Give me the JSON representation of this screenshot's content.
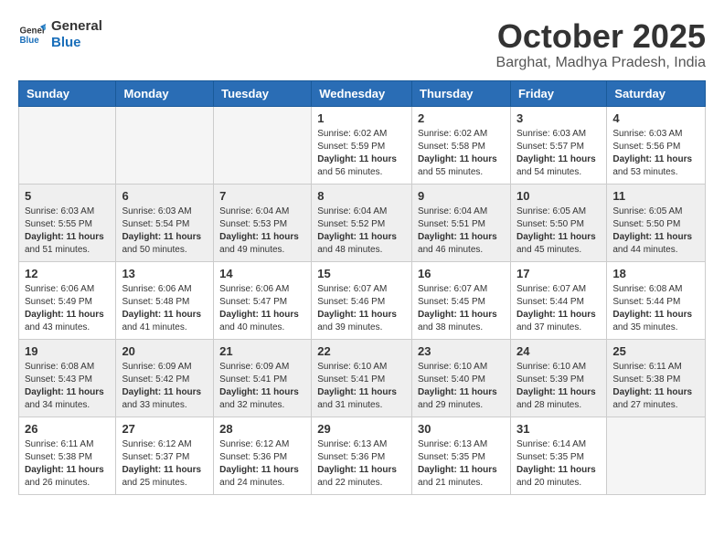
{
  "header": {
    "logo_line1": "General",
    "logo_line2": "Blue",
    "month_title": "October 2025",
    "subtitle": "Barghat, Madhya Pradesh, India"
  },
  "weekdays": [
    "Sunday",
    "Monday",
    "Tuesday",
    "Wednesday",
    "Thursday",
    "Friday",
    "Saturday"
  ],
  "weeks": [
    [
      {
        "day": "",
        "info": ""
      },
      {
        "day": "",
        "info": ""
      },
      {
        "day": "",
        "info": ""
      },
      {
        "day": "1",
        "info": "Sunrise: 6:02 AM\nSunset: 5:59 PM\nDaylight: 11 hours\nand 56 minutes."
      },
      {
        "day": "2",
        "info": "Sunrise: 6:02 AM\nSunset: 5:58 PM\nDaylight: 11 hours\nand 55 minutes."
      },
      {
        "day": "3",
        "info": "Sunrise: 6:03 AM\nSunset: 5:57 PM\nDaylight: 11 hours\nand 54 minutes."
      },
      {
        "day": "4",
        "info": "Sunrise: 6:03 AM\nSunset: 5:56 PM\nDaylight: 11 hours\nand 53 minutes."
      }
    ],
    [
      {
        "day": "5",
        "info": "Sunrise: 6:03 AM\nSunset: 5:55 PM\nDaylight: 11 hours\nand 51 minutes."
      },
      {
        "day": "6",
        "info": "Sunrise: 6:03 AM\nSunset: 5:54 PM\nDaylight: 11 hours\nand 50 minutes."
      },
      {
        "day": "7",
        "info": "Sunrise: 6:04 AM\nSunset: 5:53 PM\nDaylight: 11 hours\nand 49 minutes."
      },
      {
        "day": "8",
        "info": "Sunrise: 6:04 AM\nSunset: 5:52 PM\nDaylight: 11 hours\nand 48 minutes."
      },
      {
        "day": "9",
        "info": "Sunrise: 6:04 AM\nSunset: 5:51 PM\nDaylight: 11 hours\nand 46 minutes."
      },
      {
        "day": "10",
        "info": "Sunrise: 6:05 AM\nSunset: 5:50 PM\nDaylight: 11 hours\nand 45 minutes."
      },
      {
        "day": "11",
        "info": "Sunrise: 6:05 AM\nSunset: 5:50 PM\nDaylight: 11 hours\nand 44 minutes."
      }
    ],
    [
      {
        "day": "12",
        "info": "Sunrise: 6:06 AM\nSunset: 5:49 PM\nDaylight: 11 hours\nand 43 minutes."
      },
      {
        "day": "13",
        "info": "Sunrise: 6:06 AM\nSunset: 5:48 PM\nDaylight: 11 hours\nand 41 minutes."
      },
      {
        "day": "14",
        "info": "Sunrise: 6:06 AM\nSunset: 5:47 PM\nDaylight: 11 hours\nand 40 minutes."
      },
      {
        "day": "15",
        "info": "Sunrise: 6:07 AM\nSunset: 5:46 PM\nDaylight: 11 hours\nand 39 minutes."
      },
      {
        "day": "16",
        "info": "Sunrise: 6:07 AM\nSunset: 5:45 PM\nDaylight: 11 hours\nand 38 minutes."
      },
      {
        "day": "17",
        "info": "Sunrise: 6:07 AM\nSunset: 5:44 PM\nDaylight: 11 hours\nand 37 minutes."
      },
      {
        "day": "18",
        "info": "Sunrise: 6:08 AM\nSunset: 5:44 PM\nDaylight: 11 hours\nand 35 minutes."
      }
    ],
    [
      {
        "day": "19",
        "info": "Sunrise: 6:08 AM\nSunset: 5:43 PM\nDaylight: 11 hours\nand 34 minutes."
      },
      {
        "day": "20",
        "info": "Sunrise: 6:09 AM\nSunset: 5:42 PM\nDaylight: 11 hours\nand 33 minutes."
      },
      {
        "day": "21",
        "info": "Sunrise: 6:09 AM\nSunset: 5:41 PM\nDaylight: 11 hours\nand 32 minutes."
      },
      {
        "day": "22",
        "info": "Sunrise: 6:10 AM\nSunset: 5:41 PM\nDaylight: 11 hours\nand 31 minutes."
      },
      {
        "day": "23",
        "info": "Sunrise: 6:10 AM\nSunset: 5:40 PM\nDaylight: 11 hours\nand 29 minutes."
      },
      {
        "day": "24",
        "info": "Sunrise: 6:10 AM\nSunset: 5:39 PM\nDaylight: 11 hours\nand 28 minutes."
      },
      {
        "day": "25",
        "info": "Sunrise: 6:11 AM\nSunset: 5:38 PM\nDaylight: 11 hours\nand 27 minutes."
      }
    ],
    [
      {
        "day": "26",
        "info": "Sunrise: 6:11 AM\nSunset: 5:38 PM\nDaylight: 11 hours\nand 26 minutes."
      },
      {
        "day": "27",
        "info": "Sunrise: 6:12 AM\nSunset: 5:37 PM\nDaylight: 11 hours\nand 25 minutes."
      },
      {
        "day": "28",
        "info": "Sunrise: 6:12 AM\nSunset: 5:36 PM\nDaylight: 11 hours\nand 24 minutes."
      },
      {
        "day": "29",
        "info": "Sunrise: 6:13 AM\nSunset: 5:36 PM\nDaylight: 11 hours\nand 22 minutes."
      },
      {
        "day": "30",
        "info": "Sunrise: 6:13 AM\nSunset: 5:35 PM\nDaylight: 11 hours\nand 21 minutes."
      },
      {
        "day": "31",
        "info": "Sunrise: 6:14 AM\nSunset: 5:35 PM\nDaylight: 11 hours\nand 20 minutes."
      },
      {
        "day": "",
        "info": ""
      }
    ]
  ]
}
